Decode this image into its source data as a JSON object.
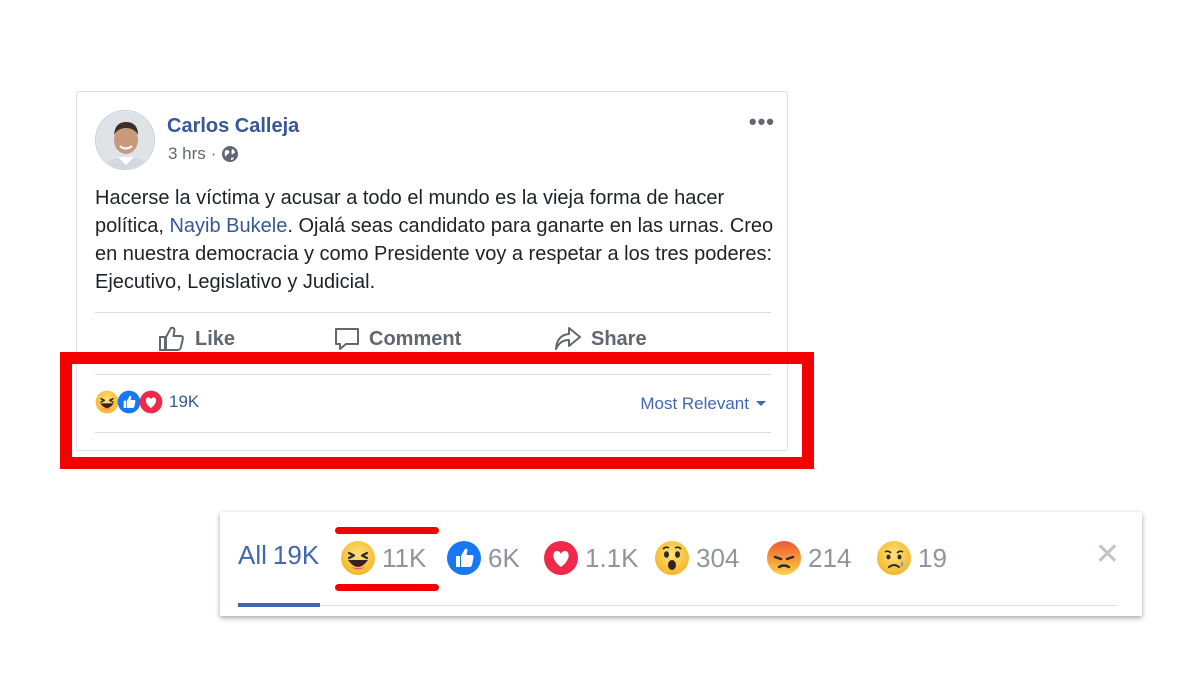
{
  "post": {
    "author": "Carlos Calleja",
    "time": "3 hrs",
    "meta_separator": "·",
    "more_label": "•••",
    "text_before": "Hacerse la víctima y acusar a todo el mundo es la vieja forma de hacer política, ",
    "mention": "Nayib Bukele",
    "text_after": ". Ojalá seas candidato para ganarte en las urnas. Creo en nuestra democracia y como Presidente voy a respetar a los tres poderes: Ejecutivo, Legislativo y Judicial.",
    "actions": {
      "like": "Like",
      "comment": "Comment",
      "share": "Share"
    },
    "reactions_total": "19K",
    "sort_label": "Most Relevant",
    "reaction_icons": [
      "haha",
      "like",
      "love"
    ]
  },
  "reactions_panel": {
    "all_label": "All",
    "all_count": "19K",
    "tabs": [
      {
        "icon": "haha",
        "count": "11K"
      },
      {
        "icon": "like",
        "count": "6K"
      },
      {
        "icon": "love",
        "count": "1.1K"
      },
      {
        "icon": "wow",
        "count": "304"
      },
      {
        "icon": "angry",
        "count": "214"
      },
      {
        "icon": "sad",
        "count": "19"
      }
    ],
    "close_label": "✕"
  },
  "colors": {
    "link_blue": "#365899",
    "accent_blue": "#4267b2",
    "highlight_red": "#f30000",
    "muted_gray": "#90949c"
  }
}
